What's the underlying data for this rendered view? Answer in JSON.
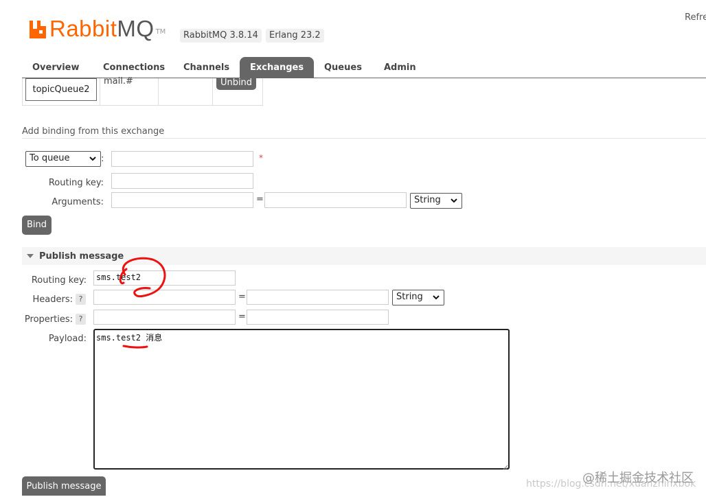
{
  "header": {
    "logo_rabbit": "Rabbit",
    "logo_mq": "MQ",
    "logo_tm": "TM",
    "rabbitmq_version": "RabbitMQ 3.8.14",
    "erlang_version": "Erlang 23.2",
    "refresh_text": "Refre"
  },
  "tabs": [
    {
      "label": "Overview"
    },
    {
      "label": "Connections"
    },
    {
      "label": "Channels"
    },
    {
      "label": "Exchanges",
      "active": true
    },
    {
      "label": "Queues"
    },
    {
      "label": "Admin"
    }
  ],
  "bindings_row": {
    "queue": "topicQueue2",
    "routing_key": "mail.#",
    "unbind_label": "Unbind"
  },
  "add_binding": {
    "title": "Add binding from this exchange",
    "destination_type": "To queue",
    "required_mark": "*",
    "routing_key_label": "Routing key:",
    "arguments_label": "Arguments:",
    "equals": "=",
    "arg_type": "String",
    "bind_label": "Bind"
  },
  "publish": {
    "title": "Publish message",
    "routing_key_label": "Routing key:",
    "routing_key_value": "sms.test2",
    "headers_label": "Headers:",
    "properties_label": "Properties:",
    "help": "?",
    "equals": "=",
    "header_type": "String",
    "payload_label": "Payload:",
    "payload_value": "sms.test2 消息",
    "publish_label": "Publish message"
  },
  "watermark": {
    "text": "@稀土掘金技术社区",
    "url_text": "https://blog.csdn.net/xuanzhinxbok"
  },
  "colors": {
    "brand_orange": "#ff6600",
    "tab_active_bg": "#666666",
    "annotation_red": "#ee1111"
  }
}
